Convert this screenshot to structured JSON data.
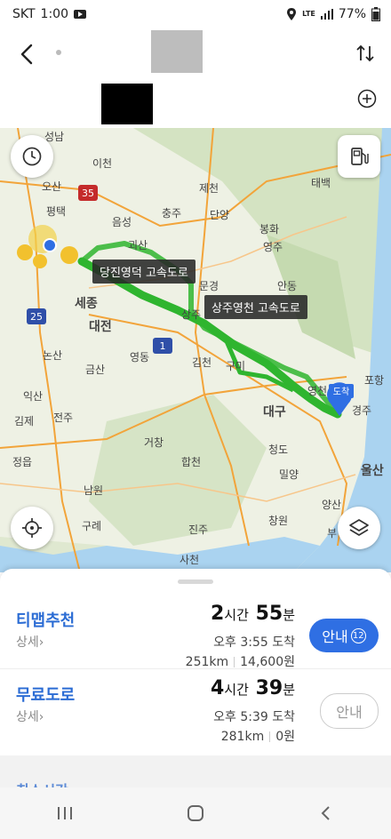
{
  "status": {
    "carrier": "SKT",
    "time": "1:00",
    "network": "LTE",
    "battery": "77%"
  },
  "map": {
    "place_labels": [
      {
        "text": "성남"
      },
      {
        "text": "이천"
      },
      {
        "text": "오산"
      },
      {
        "text": "평택"
      },
      {
        "text": "충주"
      },
      {
        "text": "제천"
      },
      {
        "text": "단양"
      },
      {
        "text": "영주"
      },
      {
        "text": "태백"
      },
      {
        "text": "봉화"
      },
      {
        "text": "세종"
      },
      {
        "text": "대전"
      },
      {
        "text": "문경"
      },
      {
        "text": "안동"
      },
      {
        "text": "상주"
      },
      {
        "text": "김천"
      },
      {
        "text": "구미"
      },
      {
        "text": "영천"
      },
      {
        "text": "대구"
      },
      {
        "text": "경주"
      },
      {
        "text": "포항"
      },
      {
        "text": "울산"
      },
      {
        "text": "전주"
      },
      {
        "text": "김제"
      },
      {
        "text": "정읍"
      },
      {
        "text": "남원"
      },
      {
        "text": "논산"
      },
      {
        "text": "익산"
      },
      {
        "text": "진주"
      },
      {
        "text": "창원"
      },
      {
        "text": "사천"
      },
      {
        "text": "합천"
      },
      {
        "text": "밀양"
      },
      {
        "text": "양산"
      },
      {
        "text": "영동"
      },
      {
        "text": "금산"
      },
      {
        "text": "청도"
      },
      {
        "text": "거창"
      },
      {
        "text": "구례"
      },
      {
        "text": "부"
      },
      {
        "text": "음성"
      },
      {
        "text": "괴산"
      }
    ],
    "road_labels": [
      "당진영덕 고속도로",
      "상주영천 고속도로"
    ],
    "shields": [
      "35",
      "25",
      "1"
    ],
    "destination_label": "도착",
    "route_color": "#2fb52f"
  },
  "routes": [
    {
      "name": "티맵추천",
      "detail": "상세",
      "time_h": "2",
      "time_h_unit": "시간",
      "time_m": "55",
      "time_m_unit": "분",
      "arrival": "오후 3:55 도착",
      "distance": "251km",
      "toll": "14,600원",
      "button": "안내",
      "badge": "12"
    },
    {
      "name": "무료도로",
      "detail": "상세",
      "time_h": "4",
      "time_h_unit": "시간",
      "time_m": "39",
      "time_m_unit": "분",
      "arrival": "오후 5:39 도착",
      "distance": "281km",
      "toll": "0원",
      "button": "안내"
    }
  ],
  "cut_off_route": "최소시간"
}
